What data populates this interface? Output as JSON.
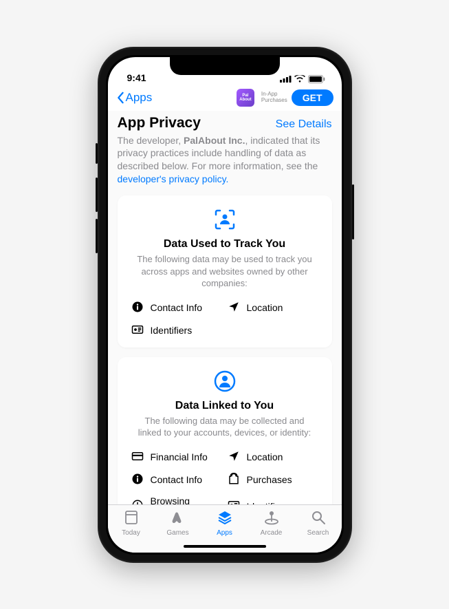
{
  "status": {
    "time": "9:41"
  },
  "nav": {
    "back": "Apps",
    "app_name": "Pal\nAbout",
    "iap_line1": "In-App",
    "iap_line2": "Purchases",
    "get": "GET"
  },
  "header": {
    "title": "App Privacy",
    "see_details": "See Details",
    "desc_1": "The developer, ",
    "developer": "PalAbout Inc.",
    "desc_2": ", indicated that its privacy practices include handling of data as described below. For more information, see the ",
    "link": "developer's privacy policy.",
    "desc_3": ""
  },
  "cards": [
    {
      "title": "Data Used to Track You",
      "desc": "The following data may be used to track you across apps and websites owned by other companies:",
      "items": [
        {
          "icon": "info",
          "label": "Contact Info"
        },
        {
          "icon": "location",
          "label": "Location"
        },
        {
          "icon": "identifiers",
          "label": "Identifiers"
        }
      ]
    },
    {
      "title": "Data Linked to You",
      "desc": "The following data may be collected and linked to your accounts, devices, or identity:",
      "items": [
        {
          "icon": "financial",
          "label": "Financial Info"
        },
        {
          "icon": "location",
          "label": "Location"
        },
        {
          "icon": "info",
          "label": "Contact Info"
        },
        {
          "icon": "purchases",
          "label": "Purchases"
        },
        {
          "icon": "history",
          "label": "Browsing History"
        },
        {
          "icon": "identifiers",
          "label": "Identifiers"
        }
      ]
    }
  ],
  "tabs": [
    {
      "id": "today",
      "label": "Today"
    },
    {
      "id": "games",
      "label": "Games"
    },
    {
      "id": "apps",
      "label": "Apps"
    },
    {
      "id": "arcade",
      "label": "Arcade"
    },
    {
      "id": "search",
      "label": "Search"
    }
  ]
}
